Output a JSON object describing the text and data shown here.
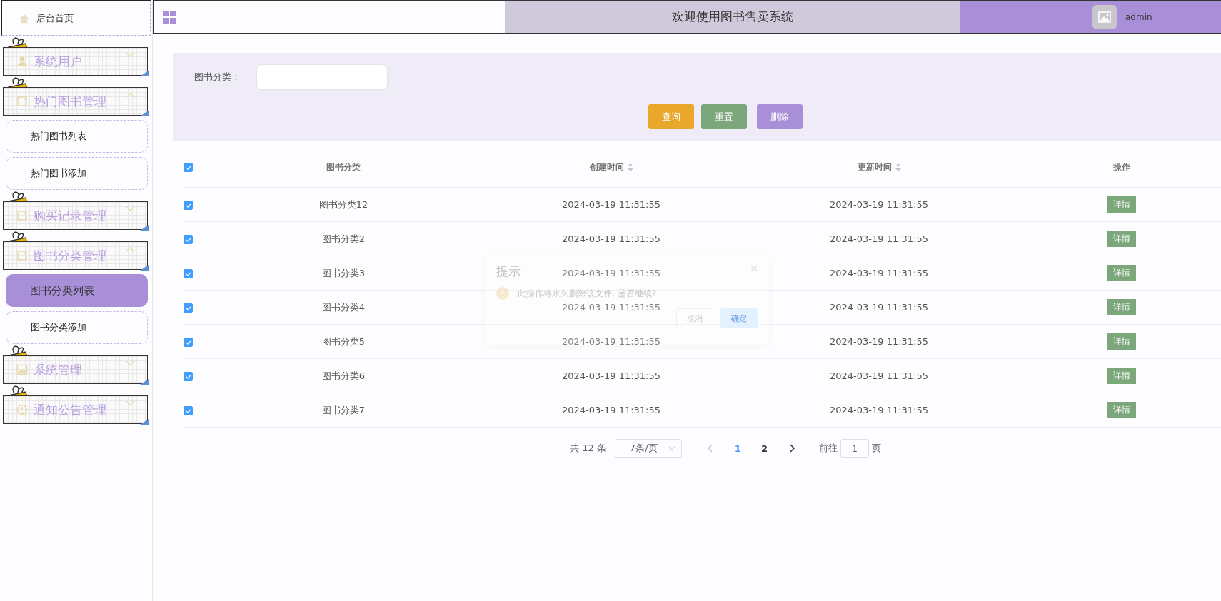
{
  "sidebar": {
    "home": {
      "label": "后台首页"
    },
    "menus": [
      {
        "label": "系统用户",
        "kind": "user",
        "expanded": false
      },
      {
        "label": "热门图书管理",
        "kind": "note",
        "expanded": true,
        "children": [
          {
            "label": "热门图书列表",
            "selected": false
          },
          {
            "label": "热门图书添加",
            "selected": false
          }
        ]
      },
      {
        "label": "购买记录管理",
        "kind": "note",
        "expanded": false
      },
      {
        "label": "图书分类管理",
        "kind": "note",
        "expanded": true,
        "children": [
          {
            "label": "图书分类列表",
            "selected": true
          },
          {
            "label": "图书分类添加",
            "selected": false
          }
        ]
      },
      {
        "label": "系统管理",
        "kind": "image",
        "expanded": false
      },
      {
        "label": "通知公告管理",
        "kind": "info",
        "expanded": false
      }
    ]
  },
  "header": {
    "title": "欢迎使用图书售卖系统",
    "user": "admin"
  },
  "filter": {
    "label": "图书分类：",
    "buttons": [
      {
        "label": "查询",
        "color": "#e9a72b"
      },
      {
        "label": "重置",
        "color": "#7ba77b"
      },
      {
        "label": "删除",
        "color": "#a98fd8"
      }
    ]
  },
  "table": {
    "all_checked": true,
    "columns": [
      {
        "label": "图书分类",
        "sortable": false
      },
      {
        "label": "创建时间",
        "sortable": true
      },
      {
        "label": "更新时间",
        "sortable": true
      },
      {
        "label": "操作",
        "sortable": false
      }
    ],
    "rows": [
      {
        "checked": true,
        "name": "图书分类12",
        "created": "2024-03-19 11:31:55",
        "updated": "2024-03-19 11:31:55",
        "action": "详情"
      },
      {
        "checked": true,
        "name": "图书分类2",
        "created": "2024-03-19 11:31:55",
        "updated": "2024-03-19 11:31:55",
        "action": "详情"
      },
      {
        "checked": true,
        "name": "图书分类3",
        "created": "2024-03-19 11:31:55",
        "updated": "2024-03-19 11:31:55",
        "action": "详情"
      },
      {
        "checked": true,
        "name": "图书分类4",
        "created": "2024-03-19 11:31:55",
        "updated": "2024-03-19 11:31:55",
        "action": "详情"
      },
      {
        "checked": true,
        "name": "图书分类5",
        "created": "2024-03-19 11:31:55",
        "updated": "2024-03-19 11:31:55",
        "action": "详情"
      },
      {
        "checked": true,
        "name": "图书分类6",
        "created": "2024-03-19 11:31:55",
        "updated": "2024-03-19 11:31:55",
        "action": "详情"
      },
      {
        "checked": true,
        "name": "图书分类7",
        "created": "2024-03-19 11:31:55",
        "updated": "2024-03-19 11:31:55",
        "action": "详情"
      }
    ]
  },
  "pagination": {
    "total": "共 12 条",
    "page_size": "7条/页",
    "pages": [
      {
        "label": "1",
        "selected": true
      },
      {
        "label": "2",
        "selected": false
      }
    ],
    "goto_label": "前往",
    "goto_value": "1",
    "goto_suffix": "页"
  },
  "dialog": {
    "title": "提示",
    "message": "此操作将永久删除该文件, 是否继续?",
    "buttons": [
      {
        "label": "取消",
        "kind": "secondary"
      },
      {
        "label": "确定",
        "kind": "primary"
      }
    ]
  }
}
